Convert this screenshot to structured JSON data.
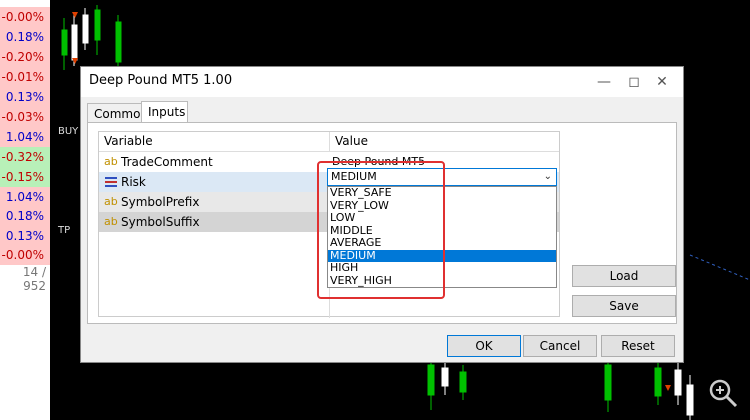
{
  "sidebar": {
    "items": [
      {
        "label": "-0.00%",
        "kind": "neg"
      },
      {
        "label": "0.18%",
        "kind": "pos"
      },
      {
        "label": "-0.20%",
        "kind": "neg"
      },
      {
        "label": "-0.01%",
        "kind": "neg"
      },
      {
        "label": "0.13%",
        "kind": "pos"
      },
      {
        "label": "-0.03%",
        "kind": "neg"
      },
      {
        "label": "1.04%",
        "kind": "pos"
      },
      {
        "label": "-0.32%",
        "kind": "green"
      },
      {
        "label": "-0.15%",
        "kind": "green"
      },
      {
        "label": "1.04%",
        "kind": "pos"
      },
      {
        "label": "0.18%",
        "kind": "pos"
      },
      {
        "label": "0.13%",
        "kind": "pos"
      },
      {
        "label": "-0.00%",
        "kind": "neg"
      }
    ],
    "count": "14 / 952"
  },
  "chart": {
    "buy_label": "BUY",
    "tp_label": "TP"
  },
  "dialog": {
    "title": "Deep Pound MT5 1.00",
    "tabs": {
      "common": "Common",
      "inputs": "Inputs"
    },
    "columns": {
      "variable": "Variable",
      "value": "Value"
    },
    "rows": [
      {
        "name": "TradeComment",
        "value": "Deep Pound MT5",
        "icon": "ab"
      },
      {
        "name": "Risk",
        "value": "MEDIUM",
        "icon": "list"
      },
      {
        "name": "SymbolPrefix",
        "value": "",
        "icon": "ab"
      },
      {
        "name": "SymbolSuffix",
        "value": "",
        "icon": "ab"
      }
    ],
    "dropdown": {
      "selected": "MEDIUM",
      "options": [
        "VERY_SAFE",
        "VERY_LOW",
        "LOW",
        "MIDDLE",
        "AVERAGE",
        "MEDIUM",
        "HIGH",
        "VERY_HIGH"
      ]
    },
    "buttons": {
      "load": "Load",
      "save": "Save",
      "ok": "OK",
      "cancel": "Cancel",
      "reset": "Reset"
    }
  },
  "colors": {
    "accent": "#0078d7",
    "highlight_box": "#e03030"
  }
}
